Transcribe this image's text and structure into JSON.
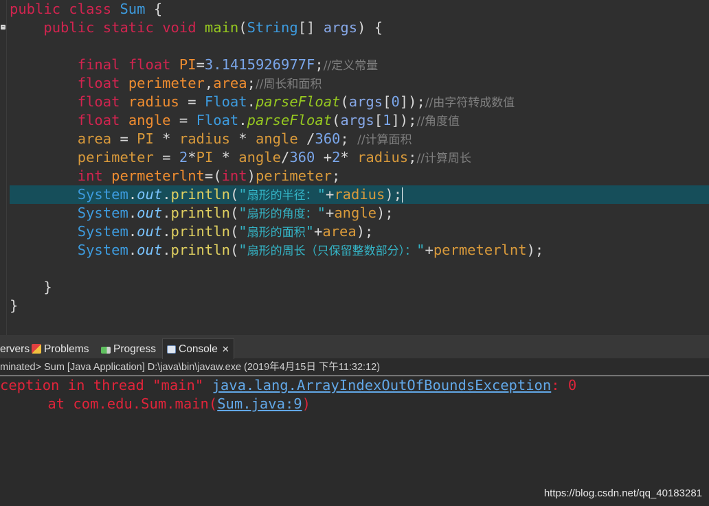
{
  "editor": {
    "fold_marker": "−",
    "lines": {
      "l1": {
        "kw1": "public",
        "kw2": "class",
        "cls": "Sum",
        "p": " {"
      },
      "l2": {
        "kw1": "public",
        "kw2": "static",
        "kw3": "void",
        "fn": "main",
        "p1": "(",
        "cls": "String",
        "p2": "[] ",
        "prm": "args",
        "p3": ") {"
      },
      "l4": {
        "kw1": "final",
        "kw2": "float",
        "var": "PI",
        "p1": "=",
        "num": "3.1415926977F",
        "p2": ";",
        "cmt": "//定义常量"
      },
      "l5": {
        "kw": "float",
        "v1": "perimeter",
        "p1": ",",
        "v2": "area",
        "p2": ";",
        "cmt": "//周长和面积"
      },
      "l6": {
        "kw": "float",
        "v": "radius",
        "p1": " = ",
        "cls": "Float",
        "p2": ".",
        "m": "parseFloat",
        "p3": "(",
        "prm": "args",
        "p4": "[",
        "num": "0",
        "p5": "]);",
        "cmt": "//由字符转成数值"
      },
      "l7": {
        "kw": "float",
        "v": "angle",
        "p1": " = ",
        "cls": "Float",
        "p2": ".",
        "m": "parseFloat",
        "p3": "(",
        "prm": "args",
        "p4": "[",
        "num": "1",
        "p5": "]);",
        "cmt": "//角度值"
      },
      "l8": {
        "v1": "area",
        "p1": " = ",
        "v2": "PI",
        "p2": " * ",
        "v3": "radius",
        "p3": " * ",
        "v4": "angle",
        "p4": " /",
        "num": "360",
        "p5": "; ",
        "cmt": "//计算面积"
      },
      "l9": {
        "v1": "perimeter",
        "p1": " = ",
        "n1": "2",
        "p2": "*",
        "v2": "PI",
        "p3": " * ",
        "v3": "angle",
        "p4": "/",
        "n2": "360",
        "p5": " +",
        "n3": "2",
        "p6": "* ",
        "v4": "radius",
        "p7": ";",
        "cmt": "//计算周长"
      },
      "l10": {
        "kw1": "int",
        "v1": "permeterlnt",
        "p1": "=(",
        "kw2": "int",
        "p2": ")",
        "v2": "perimeter",
        "p3": ";"
      },
      "l11": {
        "s": "System",
        "p1": ".",
        "o": "out",
        "p2": ".",
        "m": "println",
        "p3": "(",
        "q1": "\"",
        "str": "扇形的半径：",
        "q2": "\"",
        "p4": "+",
        "v": "radius",
        "p5": ");"
      },
      "l12": {
        "s": "System",
        "p1": ".",
        "o": "out",
        "p2": ".",
        "m": "println",
        "p3": "(",
        "q1": "\"",
        "str": "扇形的角度：",
        "q2": "\"",
        "p4": "+",
        "v": "angle",
        "p5": ");"
      },
      "l13": {
        "s": "System",
        "p1": ".",
        "o": "out",
        "p2": ".",
        "m": "println",
        "p3": "(",
        "q1": "\"",
        "str": "扇形的面积",
        "q2": "\"",
        "p4": "+",
        "v": "area",
        "p5": ");"
      },
      "l14": {
        "s": "System",
        "p1": ".",
        "o": "out",
        "p2": ".",
        "m": "println",
        "p3": "(",
        "q1": "\"",
        "str": "扇形的周长（只保留整数部分）：",
        "q2": "\"",
        "p4": "+",
        "v": "permeterlnt",
        "p5": ");"
      },
      "l16": {
        "p": "}"
      },
      "l17": {
        "p": "}"
      }
    }
  },
  "tabs": {
    "servers": "ervers",
    "problems": "Problems",
    "progress": "Progress",
    "console": "Console",
    "close": "✕"
  },
  "console": {
    "header": "minated> Sum [Java Application] D:\\java\\bin\\javaw.exe (2019年4月15日 下午11:32:12)",
    "line1_prefix": "ception in thread \"main\" ",
    "line1_link": "java.lang.ArrayIndexOutOfBoundsException",
    "line1_suffix": ": 0",
    "line2_prefix": "    at com.edu.Sum.main(",
    "line2_link": "Sum.java:9",
    "line2_suffix": ")"
  },
  "watermark": "https://blog.csdn.net/qq_40183281",
  "colors": {
    "background": "#2f2f2f",
    "keyword": "#d1244f",
    "class": "#3d9bde",
    "method": "#96c820",
    "variable": "#f08d30",
    "comment": "#7f7f7f",
    "error": "#e0243a",
    "highlight_line": "#164e5a"
  }
}
